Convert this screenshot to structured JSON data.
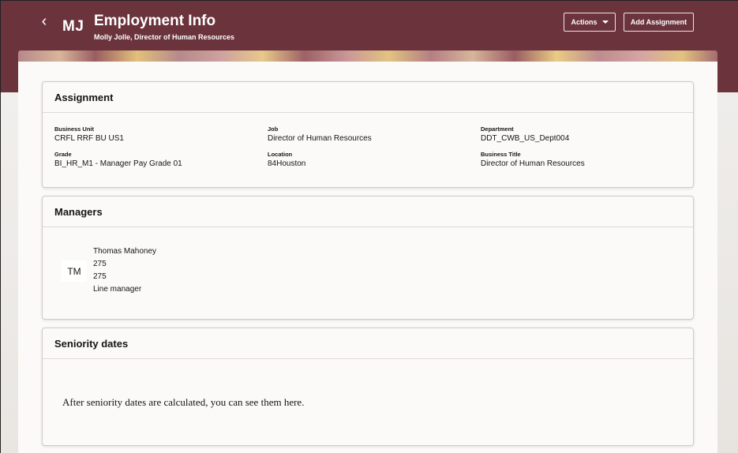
{
  "header": {
    "back_icon": "chevron-left-icon",
    "avatar_initials": "MJ",
    "title": "Employment Info",
    "subtitle": "Molly Jolle, Director of Human Resources",
    "actions_label": "Actions",
    "add_assignment_label": "Add Assignment",
    "brand_color": "#6b333c"
  },
  "assignment": {
    "title": "Assignment",
    "fields": [
      {
        "label": "Business Unit",
        "value": "CRFL RRF BU US1"
      },
      {
        "label": "Job",
        "value": "Director of Human Resources"
      },
      {
        "label": "Department",
        "value": "DDT_CWB_US_Dept004"
      },
      {
        "label": "Grade",
        "value": "BI_HR_M1 - Manager Pay Grade 01"
      },
      {
        "label": "Location",
        "value": "84Houston"
      },
      {
        "label": "Business Title",
        "value": "Director of Human Resources"
      }
    ]
  },
  "managers": {
    "title": "Managers",
    "items": [
      {
        "initials": "TM",
        "name": "Thomas Mahoney",
        "line2": "275",
        "line3": "275",
        "type": "Line manager"
      }
    ]
  },
  "seniority": {
    "title": "Seniority dates",
    "empty_message": "After seniority dates are calculated, you can see them here."
  }
}
